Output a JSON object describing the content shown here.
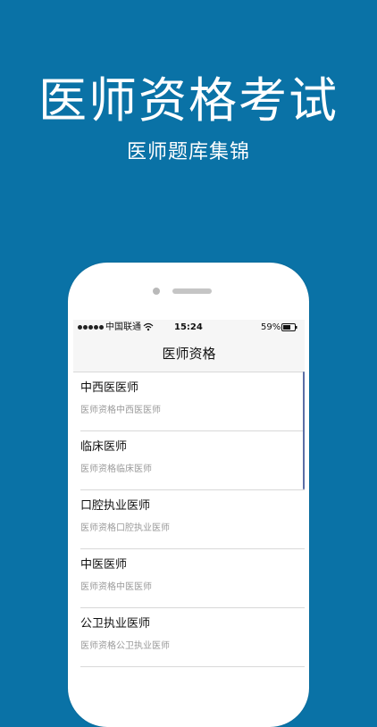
{
  "promo": {
    "title": "医师资格考试",
    "subtitle": "医师题库集锦"
  },
  "status_bar": {
    "carrier": "中国联通",
    "time": "15:24",
    "battery": "59%"
  },
  "nav": {
    "title": "医师资格"
  },
  "list": [
    {
      "title": "中西医医师",
      "subtitle": "医师资格中西医医师"
    },
    {
      "title": "临床医师",
      "subtitle": "医师资格临床医师"
    },
    {
      "title": "口腔执业医师",
      "subtitle": "医师资格口腔执业医师"
    },
    {
      "title": "中医医师",
      "subtitle": "医师资格中医医师"
    },
    {
      "title": "公卫执业医师",
      "subtitle": "医师资格公卫执业医师"
    }
  ]
}
